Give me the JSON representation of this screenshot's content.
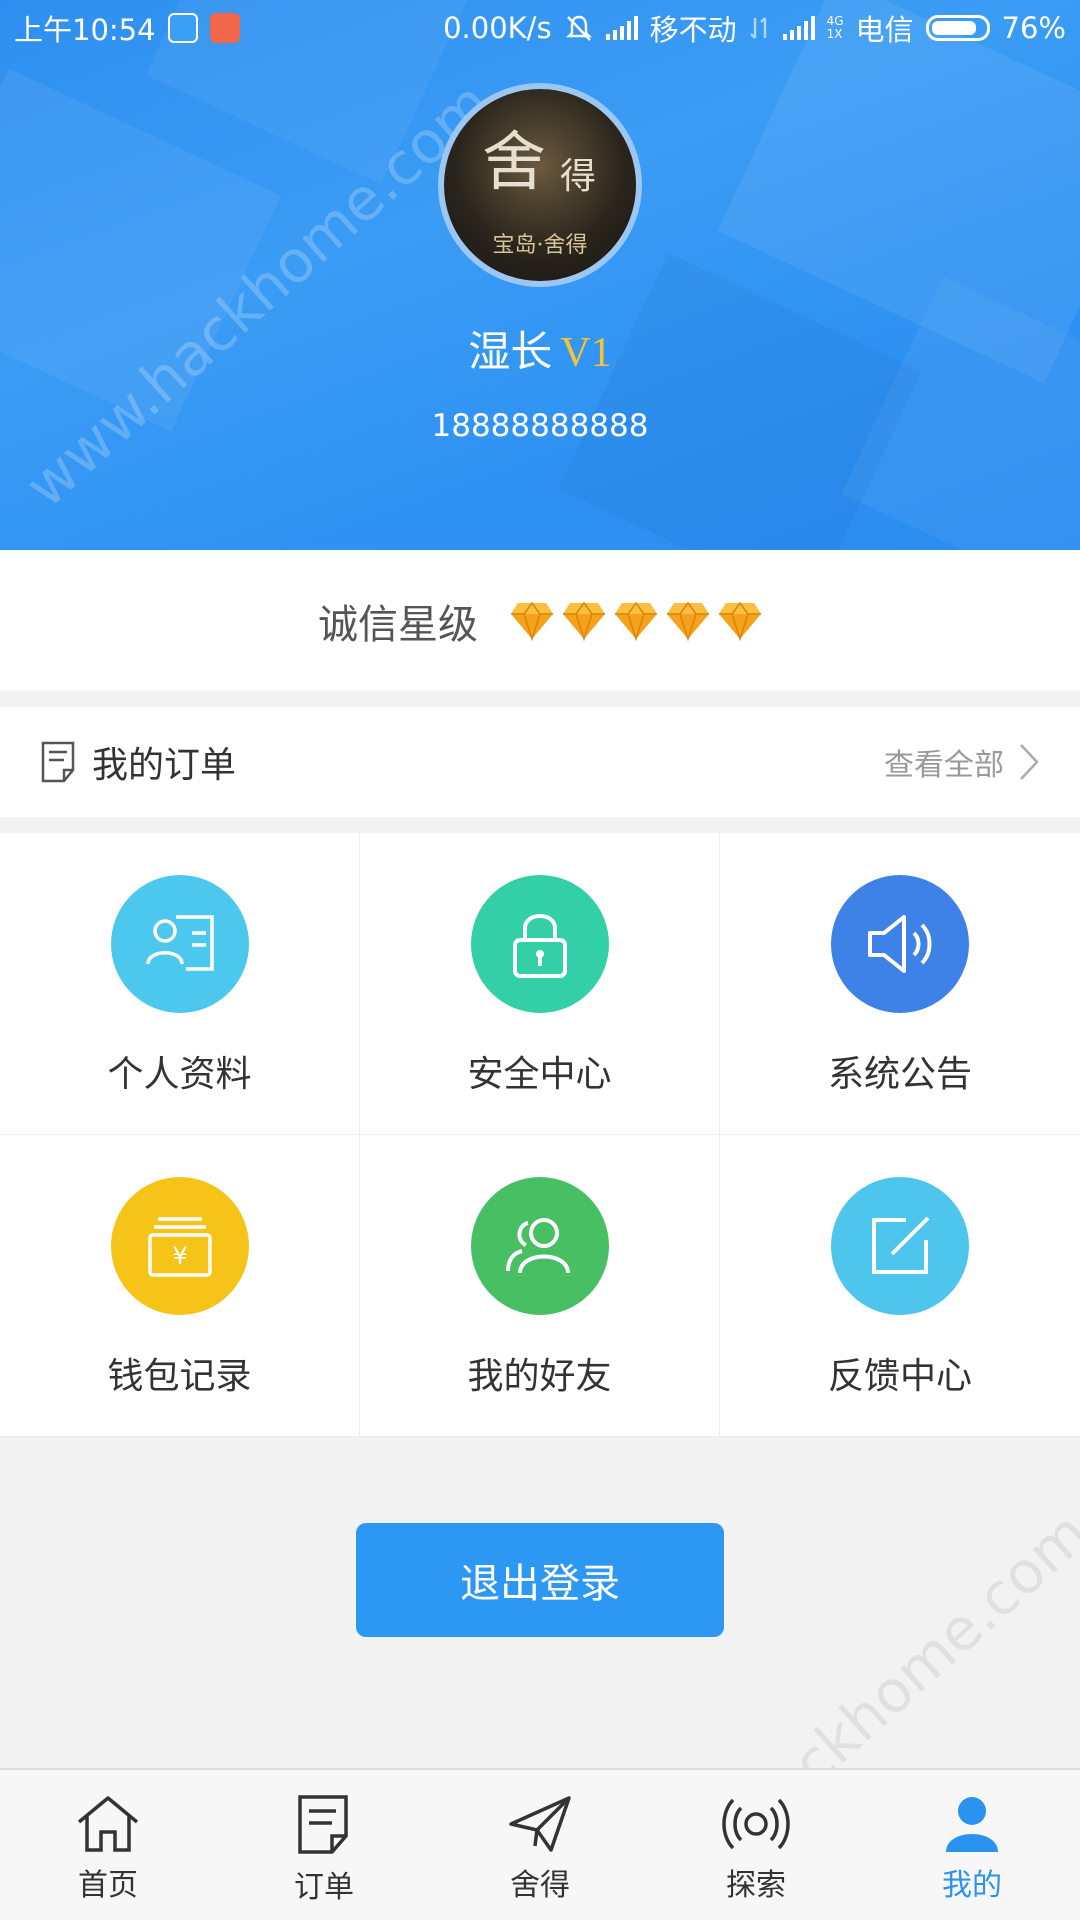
{
  "status_bar": {
    "time": "上午10:54",
    "speed": "0.00K/s",
    "carrier1": "移不动",
    "network": "4G\n1X",
    "carrier2": "电信",
    "battery": "76%"
  },
  "profile": {
    "avatar_text_main": "舍",
    "avatar_text_side": "得",
    "avatar_text_sub": "宝岛·舍得",
    "name": "湿长",
    "vip_level": "V1",
    "phone": "18888888888"
  },
  "credit": {
    "label": "诚信星级",
    "rating": 5,
    "max": 5
  },
  "orders": {
    "title": "我的订单",
    "view_all": "查看全部"
  },
  "grid": [
    {
      "label": "个人资料",
      "icon": "profile-card-icon",
      "color": "#4cc7ee"
    },
    {
      "label": "安全中心",
      "icon": "lock-icon",
      "color": "#33cfa6"
    },
    {
      "label": "系统公告",
      "icon": "speaker-icon",
      "color": "#3f82e7"
    },
    {
      "label": "钱包记录",
      "icon": "wallet-icon",
      "color": "#f6c418"
    },
    {
      "label": "我的好友",
      "icon": "friends-icon",
      "color": "#48bf63"
    },
    {
      "label": "反馈中心",
      "icon": "edit-icon",
      "color": "#4dc5ec"
    }
  ],
  "logout_label": "退出登录",
  "nav": [
    {
      "label": "首页",
      "icon": "home-icon",
      "active": false
    },
    {
      "label": "订单",
      "icon": "order-icon",
      "active": false
    },
    {
      "label": "舍得",
      "icon": "paper-plane-icon",
      "active": false
    },
    {
      "label": "探索",
      "icon": "broadcast-icon",
      "active": false
    },
    {
      "label": "我的",
      "icon": "user-icon",
      "active": true
    }
  ],
  "watermark": "www.hackhome.com",
  "colors": {
    "header_blue": "#3196f3",
    "accent_blue": "#2d98f4",
    "vip_gold": "#f8c233",
    "diamond_orange": "#f6a21c"
  }
}
